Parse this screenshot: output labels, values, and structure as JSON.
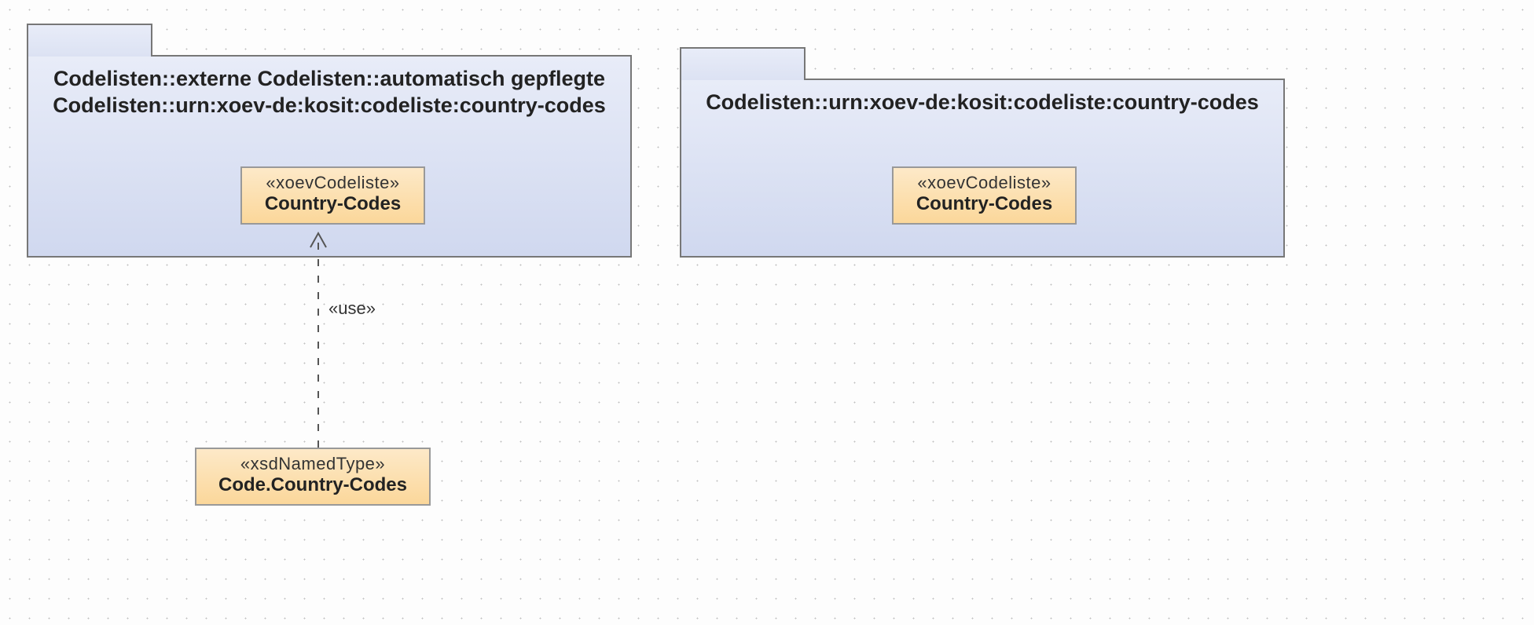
{
  "packages": {
    "left": {
      "title": "Codelisten::externe Codelisten::automatisch gepflegte Codelisten::urn:xoev-de:kosit:codeliste:country-codes",
      "classifier": {
        "stereotype": "«xoevCodeliste»",
        "name": "Country-Codes"
      }
    },
    "right": {
      "title": "Codelisten::urn:xoev-de:kosit:codeliste:country-codes",
      "classifier": {
        "stereotype": "«xoevCodeliste»",
        "name": "Country-Codes"
      }
    }
  },
  "dependency": {
    "label": "«use»",
    "source": {
      "stereotype": "«xsdNamedType»",
      "name": "Code.Country-Codes"
    }
  }
}
